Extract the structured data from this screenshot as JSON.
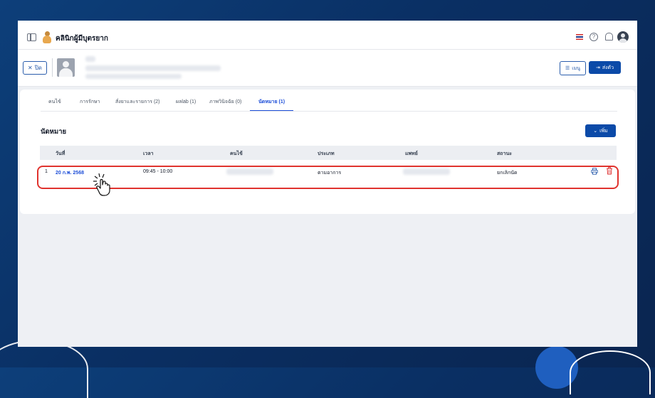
{
  "app": {
    "title": "คลินิกผู้มีบุตรยาก"
  },
  "patient_bar": {
    "close_label": "ปิด",
    "menu_label": "เมนู",
    "send_label": "ส่งตัว"
  },
  "tabs": [
    {
      "label": "คนไข้"
    },
    {
      "label": "การรักษา"
    },
    {
      "label": "สั่งยาและรายการ (2)"
    },
    {
      "label": "ผลlab (1)"
    },
    {
      "label": "ภาพวินิจฉัย (0)"
    },
    {
      "label": "นัดหมาย (1)"
    }
  ],
  "appointments": {
    "title": "นัดหมาย",
    "add_label": "เพิ่ม",
    "columns": [
      "วันที่",
      "เวลา",
      "คนไข้",
      "ประเภท",
      "แพทย์",
      "สถานะ"
    ],
    "rows": [
      {
        "index": "1",
        "date": "20 ก.พ. 2568",
        "time": "09:45 - 10:00",
        "type": "ตามอาการ",
        "status": "ยกเลิกนัด"
      }
    ]
  },
  "colors": {
    "primary": "#0b4aa8",
    "highlight": "#e0332e",
    "background": "#0a2f63"
  },
  "icons": [
    "sidebar-toggle-icon",
    "clinic-logo-icon",
    "flag-icon",
    "help-icon",
    "bell-icon",
    "user-avatar-icon",
    "close-icon",
    "menu-icon",
    "send-icon",
    "chevron-down-icon",
    "printer-icon",
    "trash-icon",
    "pointer-hand-icon"
  ]
}
